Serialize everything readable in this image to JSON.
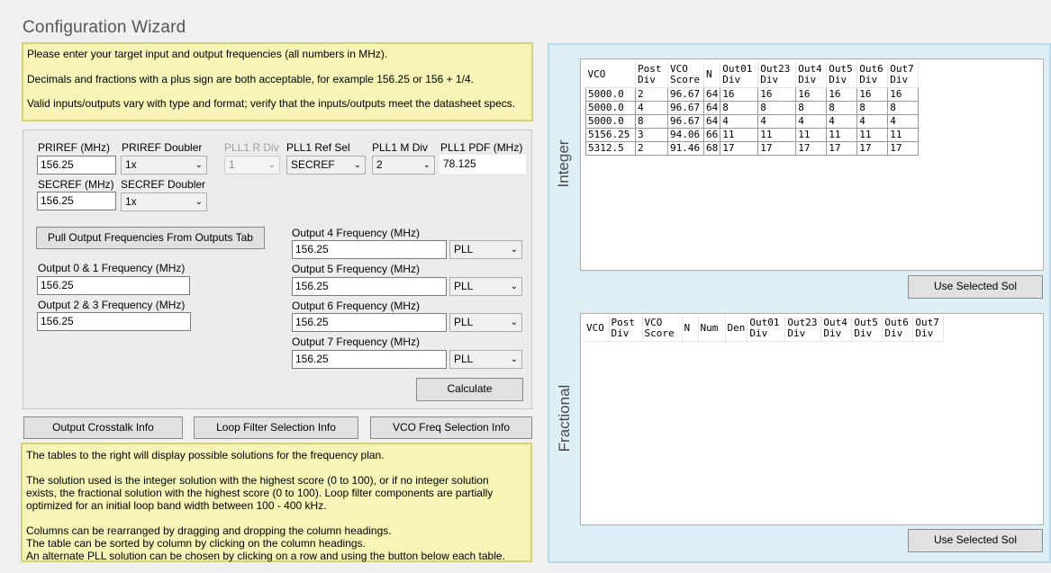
{
  "window": {
    "title": "Configuration Wizard"
  },
  "top_note": {
    "line1": "Please enter your target input and output frequencies (all numbers in MHz).",
    "line2": "Decimals and fractions with a plus sign are both acceptable, for example 156.25 or 156 + 1/4.",
    "line3": "Valid inputs/outputs vary with type and format; verify that the inputs/outputs meet the datasheet specs."
  },
  "inputs": {
    "priref_label": "PRIREF (MHz)",
    "priref_value": "156.25",
    "priref_doubler_label": "PRIREF Doubler",
    "priref_doubler_value": "1x",
    "secref_label": "SECREF (MHz)",
    "secref_value": "156.25",
    "secref_doubler_label": "SECREF Doubler",
    "secref_doubler_value": "1x",
    "pll1_r_div_label": "PLL1 R Div",
    "pll1_r_div_value": "1",
    "pll1_ref_sel_label": "PLL1 Ref Sel",
    "pll1_ref_sel_value": "SECREF",
    "pll1_m_div_label": "PLL1 M Div",
    "pll1_m_div_value": "2",
    "pll1_pdf_label": "PLL1 PDF (MHz)",
    "pll1_pdf_value": "78.125"
  },
  "outputs": {
    "pull_button": "Pull Output Frequencies From Outputs Tab",
    "out01_label": "Output 0 & 1 Frequency (MHz)",
    "out01_value": "156.25",
    "out23_label": "Output 2 & 3 Frequency (MHz)",
    "out23_value": "156.25",
    "out4_label": "Output 4 Frequency (MHz)",
    "out4_value": "156.25",
    "out4_src": "PLL",
    "out5_label": "Output 5 Frequency (MHz)",
    "out5_value": "156.25",
    "out5_src": "PLL",
    "out6_label": "Output 6 Frequency (MHz)",
    "out6_value": "156.25",
    "out6_src": "PLL",
    "out7_label": "Output 7 Frequency (MHz)",
    "out7_value": "156.25",
    "out7_src": "PLL",
    "calculate_button": "Calculate"
  },
  "info_buttons": {
    "crosstalk": "Output Crosstalk Info",
    "loop_filter": "Loop Filter Selection Info",
    "vco_freq": "VCO Freq Selection Info"
  },
  "bottom_note": {
    "p1": "The tables to the right will display possible solutions for the frequency plan.",
    "p2a": "The solution used is the integer solution with the highest score (0 to 100), or if no integer solution",
    "p2b": "exists, the fractional solution with the highest score (0 to 100). Loop filter components are partially",
    "p2c": "optimized for an initial loop band width between 100 - 400 kHz.",
    "p3a": "Columns can be rearranged by dragging and dropping the column headings.",
    "p3b": "The table can be sorted by column by clicking on the column headings.",
    "p3c": "An alternate PLL solution can be chosen by clicking on a row and using the button below each table."
  },
  "integer": {
    "label": "Integer",
    "headers": [
      [
        "VCO",
        ""
      ],
      [
        "Post",
        "Div"
      ],
      [
        "VCO",
        "Score"
      ],
      [
        "N",
        ""
      ],
      [
        "Out01",
        "Div"
      ],
      [
        "Out23",
        "Div"
      ],
      [
        "Out4",
        "Div"
      ],
      [
        "Out5",
        "Div"
      ],
      [
        "Out6",
        "Div"
      ],
      [
        "Out7",
        "Div"
      ]
    ],
    "rows": [
      [
        "5000.0",
        "2",
        "96.67",
        "64",
        "16",
        "16",
        "16",
        "16",
        "16",
        "16"
      ],
      [
        "5000.0",
        "4",
        "96.67",
        "64",
        "8",
        "8",
        "8",
        "8",
        "8",
        "8"
      ],
      [
        "5000.0",
        "8",
        "96.67",
        "64",
        "4",
        "4",
        "4",
        "4",
        "4",
        "4"
      ],
      [
        "5156.25",
        "3",
        "94.06",
        "66",
        "11",
        "11",
        "11",
        "11",
        "11",
        "11"
      ],
      [
        "5312.5",
        "2",
        "91.46",
        "68",
        "17",
        "17",
        "17",
        "17",
        "17",
        "17"
      ]
    ],
    "button": "Use Selected Sol"
  },
  "fractional": {
    "label": "Fractional",
    "headers": [
      [
        "VCO",
        ""
      ],
      [
        "Post",
        "Div"
      ],
      [
        "VCO",
        "Score"
      ],
      [
        "N",
        ""
      ],
      [
        "Num",
        ""
      ],
      [
        "Den",
        ""
      ],
      [
        "Out01",
        "Div"
      ],
      [
        "Out23",
        "Div"
      ],
      [
        "Out4",
        "Div"
      ],
      [
        "Out5",
        "Div"
      ],
      [
        "Out6",
        "Div"
      ],
      [
        "Out7",
        "Div"
      ]
    ],
    "button": "Use Selected Sol"
  },
  "icons": {
    "dropdown": "chevron-down-icon"
  }
}
